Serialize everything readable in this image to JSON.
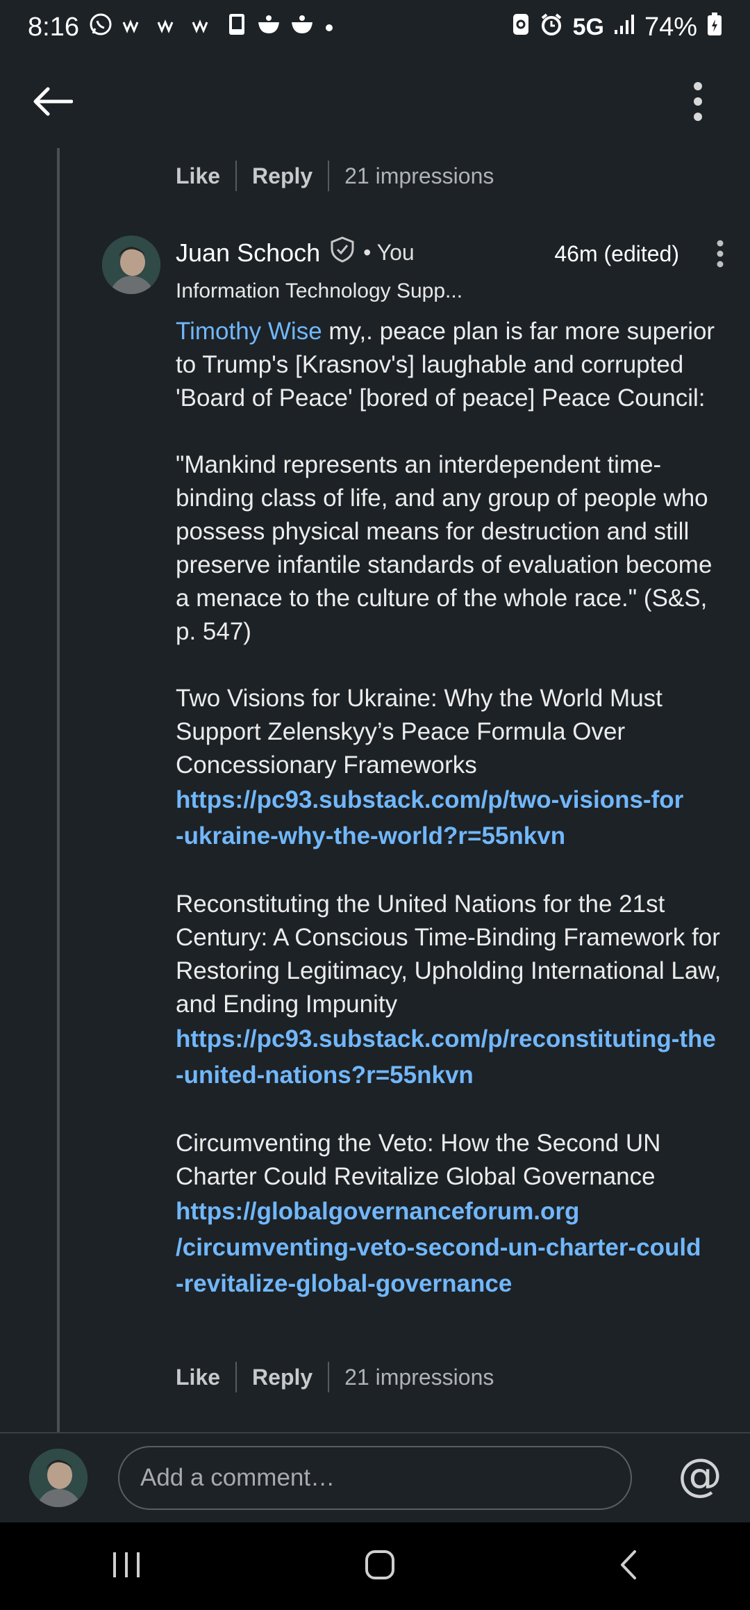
{
  "status_bar": {
    "time": "8:16",
    "network": "5G",
    "battery": "74%",
    "left_icons": [
      "whatsapp-icon",
      "notification-icon",
      "notification-icon",
      "notification-icon",
      "phone-icon",
      "bowl-icon",
      "bowl-icon",
      "dot-icon"
    ],
    "right_icons": [
      "recycle-icon",
      "alarm-icon",
      "signal-icon",
      "battery-icon"
    ]
  },
  "top_bar": {
    "back_icon": "arrow-left-icon",
    "menu_icon": "more-vertical-icon"
  },
  "prev_actions": {
    "like": "Like",
    "reply": "Reply",
    "impressions": "21 impressions"
  },
  "comment": {
    "author": "Juan Schoch",
    "badge_icon": "verified-shield-icon",
    "you_label": "• You",
    "time": "46m (edited)",
    "headline": "Information Technology Supp...",
    "mention": "Timothy Wise",
    "p1_rest": " my,. peace plan is far more superior to Trump's [Krasnov's] laughable and corrupted 'Board of Peace' [bored of peace] Peace Council:",
    "p2": "\"Mankind represents an interdependent time-binding class of life, and any group of people who possess physical means for destruction and still preserve infantile standards of evaluation become a menace to the culture of the whole race.\" (S&S, p. 547)",
    "p3": "Two Visions for Ukraine: Why the World Must Support Zelenskyy’s Peace Formula Over Concessionary Frameworks",
    "link1_a": "https://pc93.substack.com/p/two-visions-for",
    "link1_b": "-ukraine-why-the-world?r=55nkvn",
    "p4": "Reconstituting the United Nations for the 21st Century: A Conscious Time-Binding Framework for Restoring Legitimacy, Upholding International Law, and Ending Impunity",
    "link2_a": "https://pc93.substack.com/p/reconstituting-the",
    "link2_b": "-united-nations?r=55nkvn",
    "p5": "Circumventing the Veto: How the Second UN Charter Could Revitalize Global Governance",
    "link3_a": "https://globalgovernanceforum.org",
    "link3_b": "/circumventing-veto-second-un-charter-could",
    "link3_c": "-revitalize-global-governance"
  },
  "comment_actions": {
    "like": "Like",
    "reply": "Reply",
    "impressions": "21 impressions"
  },
  "composer": {
    "placeholder": "Add a comment…",
    "mention_symbol": "@"
  },
  "nav_bar": {
    "icons": [
      "recents-icon",
      "home-icon",
      "back-icon"
    ]
  },
  "colors": {
    "background": "#1d2226",
    "link": "#71b7fb",
    "text": "#ececec",
    "muted": "#b0b3b6"
  }
}
